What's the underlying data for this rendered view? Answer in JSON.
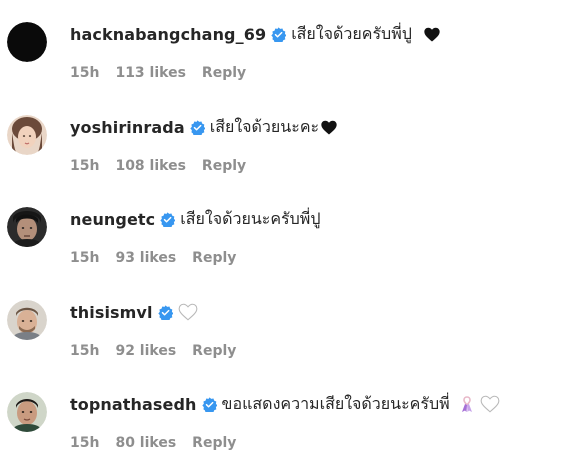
{
  "comments": [
    {
      "username": "hacknabangchang_69",
      "text": "เสียใจด้วยครับพี่ปู",
      "emoji": "black-heart-icon",
      "time": "15h",
      "likes": "113 likes",
      "reply": "Reply"
    },
    {
      "username": "yoshirinrada",
      "text": "เสียใจด้วยนะคะ",
      "emoji": "black-heart-icon",
      "time": "15h",
      "likes": "108 likes",
      "reply": "Reply"
    },
    {
      "username": "neungetc",
      "text": "เสียใจด้วยนะครับพี่ปู",
      "time": "15h",
      "likes": "93 likes",
      "reply": "Reply"
    },
    {
      "username": "thisismvl",
      "text": "",
      "emoji": "white-heart-icon",
      "time": "15h",
      "likes": "92 likes",
      "reply": "Reply"
    },
    {
      "username": "topnathasedh",
      "text": "ขอแสดงความเสียใจด้วยนะครับพี่",
      "emoji": "ribbon-and-white-heart-icon",
      "time": "15h",
      "likes": "80 likes",
      "reply": "Reply"
    }
  ],
  "colors": {
    "verified_badge": "#3897f0",
    "meta_text": "#8e8e8e",
    "primary_text": "#262626"
  }
}
